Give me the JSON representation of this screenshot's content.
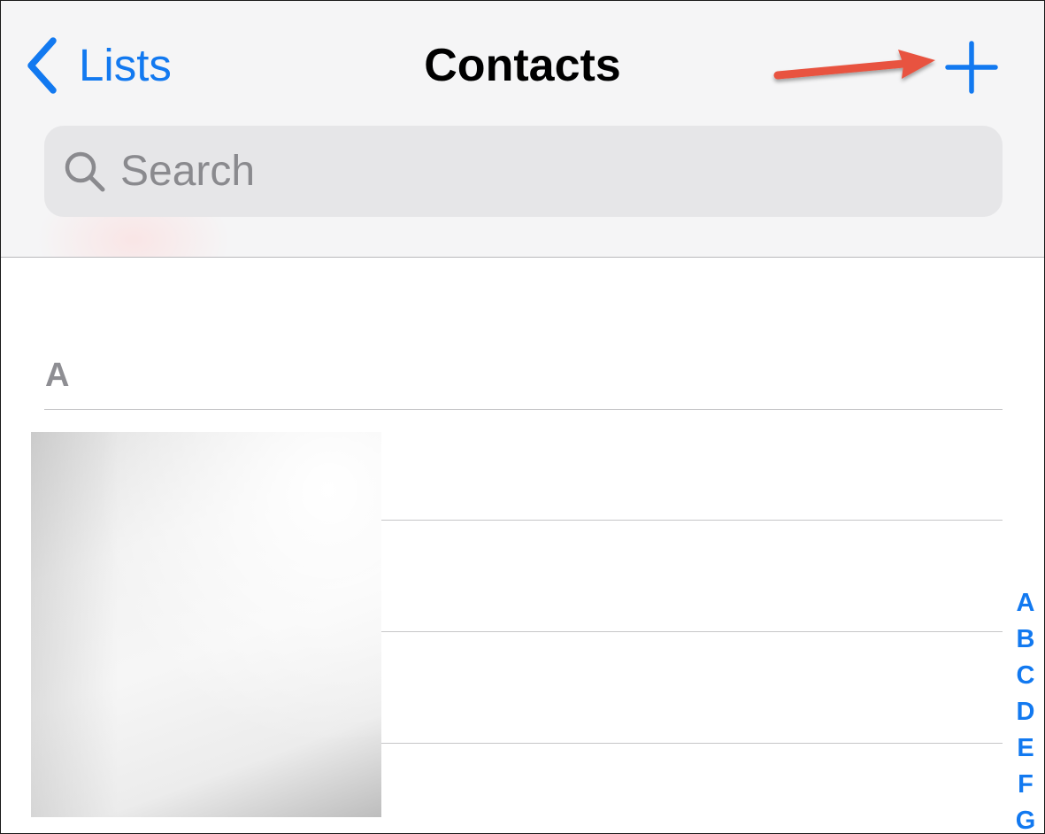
{
  "nav": {
    "back_label": "Lists",
    "title": "Contacts",
    "add_icon": "plus-icon",
    "back_icon": "chevron-left-icon"
  },
  "search": {
    "placeholder": "Search",
    "value": "",
    "icon": "search-icon"
  },
  "annotation": {
    "type": "arrow",
    "color": "#e8533f",
    "points_to": "add-button"
  },
  "contacts": {
    "section_header": "A",
    "rows": [
      "",
      "",
      "",
      ""
    ]
  },
  "index": {
    "letters": [
      "A",
      "B",
      "C",
      "D",
      "E",
      "F",
      "G"
    ]
  },
  "colors": {
    "accent": "#1279f0",
    "header_bg": "#f5f5f6",
    "search_bg": "#e6e6e8",
    "section_header": "#8e8e93",
    "divider": "#c6c6c8"
  }
}
